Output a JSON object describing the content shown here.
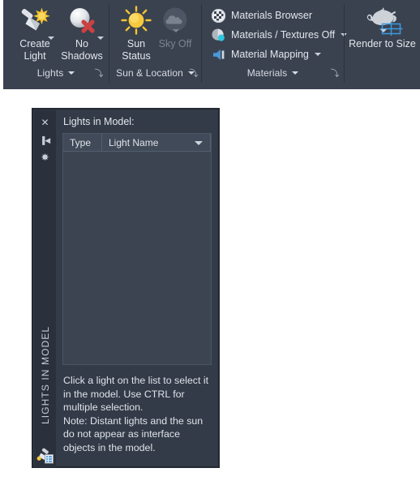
{
  "ribbon": {
    "panels": [
      {
        "name": "lights",
        "title": "Lights",
        "buttons": [
          {
            "id": "create-light",
            "label": "Create\nLight",
            "icon": "spotlight-star-icon",
            "has_caret": true,
            "disabled": false
          },
          {
            "id": "no-shadows",
            "label": "No\nShadows",
            "icon": "sphere-red-x-icon",
            "has_caret": true,
            "disabled": false
          }
        ]
      },
      {
        "name": "sun-location",
        "title": "Sun & Location",
        "has_caret": true,
        "buttons": [
          {
            "id": "sun-status",
            "label": "Sun\nStatus",
            "icon": "sun-icon",
            "has_caret": false,
            "disabled": false
          },
          {
            "id": "sky-off",
            "label": "Sky Off",
            "icon": "cloud-circle-icon",
            "has_caret": true,
            "disabled": true
          }
        ]
      },
      {
        "name": "materials",
        "title": "Materials",
        "has_caret": true,
        "rows": [
          {
            "id": "materials-browser",
            "label": "Materials Browser",
            "icon": "checkered-sphere-icon",
            "has_caret": false
          },
          {
            "id": "materials-textures-off",
            "label": "Materials / Textures Off",
            "icon": "sphere-cyan-dot-icon",
            "has_caret": true
          },
          {
            "id": "material-mapping",
            "label": "Material Mapping",
            "icon": "material-mapping-icon",
            "has_caret": true
          }
        ]
      },
      {
        "name": "render",
        "buttons": [
          {
            "id": "render-to-size",
            "label": "Render to Size",
            "icon": "teapot-grid-icon",
            "has_caret": true,
            "disabled": false
          }
        ]
      }
    ],
    "dialog_launcher_glyph": "⤵"
  },
  "palette": {
    "vertical_title": "LIGHTS IN MODEL",
    "heading": "Lights in Model:",
    "titlebar_icons": [
      {
        "id": "close",
        "name": "close-icon",
        "glyph": "✕"
      },
      {
        "id": "autohide",
        "name": "auto-hide-icon",
        "glyph": "▐◀"
      },
      {
        "id": "properties",
        "name": "properties-icon",
        "glyph": "✸"
      }
    ],
    "bottom_icon": "lights-list-icon",
    "list": {
      "columns": [
        {
          "id": "type",
          "label": "Type"
        },
        {
          "id": "name",
          "label": "Light Name"
        }
      ],
      "rows": []
    },
    "hint": "Click a light on the list to select it in the model. Use CTRL for multiple selection.\nNote: Distant lights and the sun do not appear as interface objects in the model."
  },
  "colors": {
    "ribbon_bg": "#3a4250",
    "panel_divider": "#2c323d",
    "palette_bg": "#333b48",
    "palette_titlebar": "#2b313c",
    "list_header": "#414a58",
    "list_body": "#3b4450",
    "text": "#e3e7ec",
    "text_disabled": "#7c8493",
    "accent_blue": "#3aa0e0",
    "accent_yellow": "#f5c22b",
    "accent_red": "#cf4040"
  }
}
